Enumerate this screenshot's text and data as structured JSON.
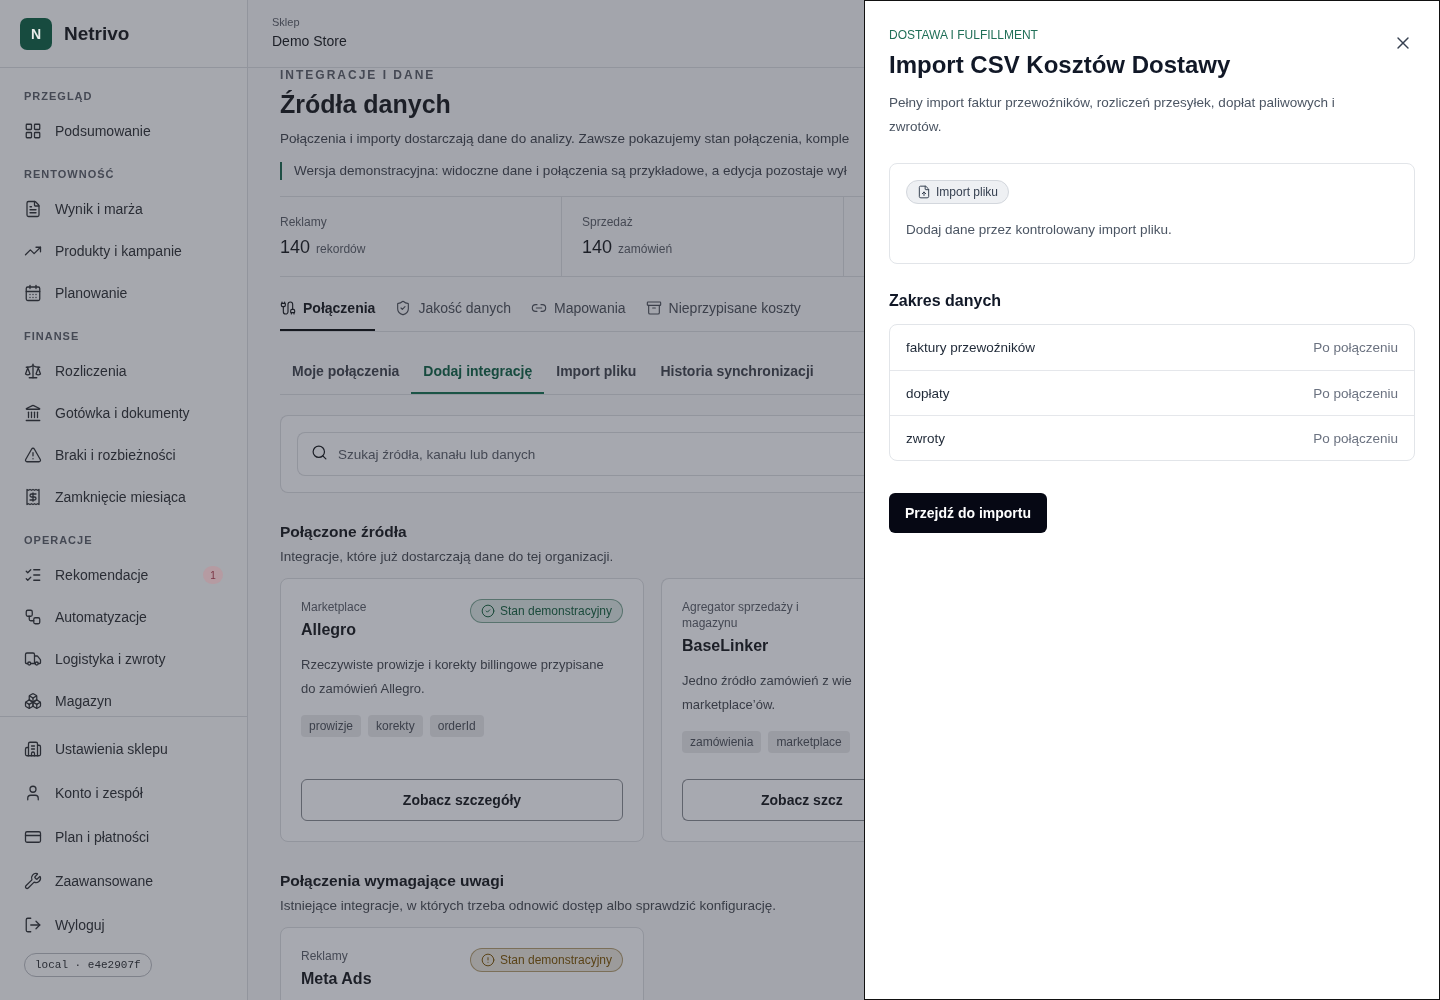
{
  "brand": {
    "logo_letter": "N",
    "name": "Netrivo"
  },
  "sidebar": {
    "sections": [
      {
        "title": "PRZEGLĄD",
        "items": [
          {
            "label": "Podsumowanie"
          }
        ]
      },
      {
        "title": "RENTOWNOŚĆ",
        "items": [
          {
            "label": "Wynik i marża"
          },
          {
            "label": "Produkty i kampanie"
          },
          {
            "label": "Planowanie"
          }
        ]
      },
      {
        "title": "FINANSE",
        "items": [
          {
            "label": "Rozliczenia"
          },
          {
            "label": "Gotówka i dokumenty"
          },
          {
            "label": "Braki i rozbieżności"
          },
          {
            "label": "Zamknięcie miesiąca"
          }
        ]
      },
      {
        "title": "OPERACJE",
        "items": [
          {
            "label": "Rekomendacje",
            "badge": "1"
          },
          {
            "label": "Automatyzacje"
          },
          {
            "label": "Logistyka i zwroty"
          },
          {
            "label": "Magazyn"
          }
        ]
      }
    ],
    "footer_items": [
      {
        "label": "Ustawienia sklepu"
      },
      {
        "label": "Konto i zespół"
      },
      {
        "label": "Plan i płatności"
      },
      {
        "label": "Zaawansowane"
      },
      {
        "label": "Wyloguj"
      }
    ],
    "version": "local · e4e2907f"
  },
  "header": {
    "label": "Sklep",
    "store": "Demo Store"
  },
  "page": {
    "eyebrow": "INTEGRACJE I DANE",
    "title": "Źródła danych",
    "description": "Połączenia i importy dostarczają dane do analizy. Zawsze pokazujemy stan połączenia, komple",
    "notice": "Wersja demonstracyjna: widoczne dane i połączenia są przykładowe, a edycja pozostaje wył"
  },
  "stats": [
    {
      "label": "Reklamy",
      "value": "140",
      "unit": "rekordów"
    },
    {
      "label": "Sprzedaż",
      "value": "140",
      "unit": "zamówień"
    }
  ],
  "tabs": [
    {
      "label": "Połączenia",
      "selected": true
    },
    {
      "label": "Jakość danych",
      "selected": false
    },
    {
      "label": "Mapowania",
      "selected": false
    },
    {
      "label": "Nieprzypisane koszty",
      "selected": false
    }
  ],
  "subtabs": [
    {
      "label": "Moje połączenia",
      "selected": false
    },
    {
      "label": "Dodaj integrację",
      "selected": true
    },
    {
      "label": "Import pliku",
      "selected": false
    },
    {
      "label": "Historia synchronizacji",
      "selected": false
    }
  ],
  "search": {
    "placeholder": "Szukaj źródła, kanału lub danych"
  },
  "sections": [
    {
      "title": "Połączone źródła",
      "subtitle": "Integracje, które już dostarczają dane do tej organizacji.",
      "cards": [
        {
          "category": "Marketplace",
          "name": "Allegro",
          "badge": {
            "label": "Stan demonstracyjny",
            "color": "#1b4a3b"
          },
          "description_lines": [
            "Rzeczywiste prowizje i korekty billingowe przypisane",
            "do zamówień Allegro."
          ],
          "tags": [
            "prowizje",
            "korekty",
            "orderId"
          ],
          "button": "Zobacz szczegóły"
        },
        {
          "category": "Agregator sprzedaży i magazynu",
          "name": "BaseLinker",
          "description_lines": [
            "Jedno źródło zamówień z wie",
            "marketplace’ów."
          ],
          "tags": [
            "zamówienia",
            "marketplace"
          ],
          "button": "Zobacz szcz"
        }
      ]
    },
    {
      "title": "Połączenia wymagające uwagi",
      "subtitle": "Istniejące integracje, w których trzeba odnowić dostęp albo sprawdzić konfigurację.",
      "cards": [
        {
          "category": "Reklamy",
          "name": "Meta Ads",
          "badge": {
            "label": "Stan demonstracyjny",
            "color": "#5a4317"
          }
        }
      ]
    }
  ],
  "drawer": {
    "eyebrow": "DOSTAWA I FULFILLMENT",
    "title": "Import CSV Kosztów Dostawy",
    "description": "Pełny import faktur przewoźników, rozliczeń przesyłek, dopłat paliwowych i zwrotów.",
    "source": {
      "chip": "Import pliku",
      "text": "Dodaj dane przez kontrolowany import pliku."
    },
    "scope_title": "Zakres danych",
    "scope_rows": [
      {
        "label": "faktury przewoźników",
        "value": "Po połączeniu"
      },
      {
        "label": "dopłaty",
        "value": "Po połączeniu"
      },
      {
        "label": "zwroty",
        "value": "Po połączeniu"
      }
    ],
    "primary_button": "Przejdź do importu"
  }
}
